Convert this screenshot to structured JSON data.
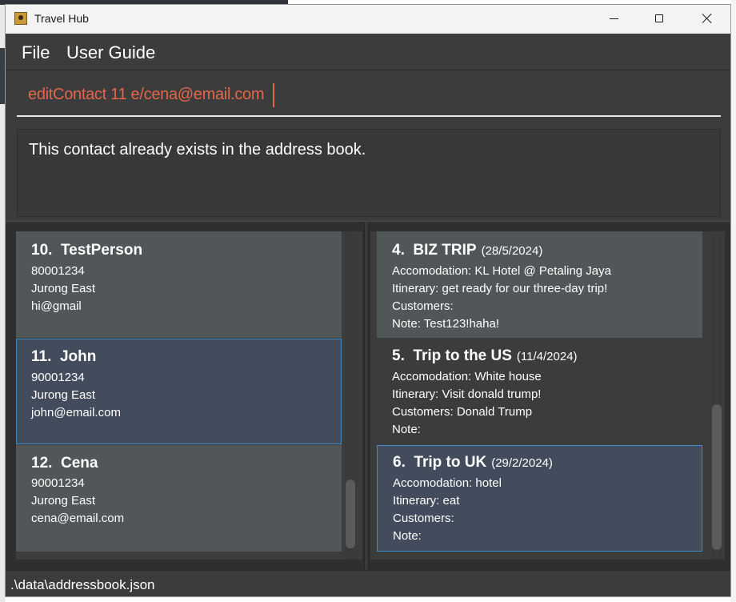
{
  "window": {
    "title": "Travel Hub"
  },
  "menu": {
    "file": "File",
    "user_guide": "User Guide"
  },
  "command": {
    "value": "editContact 11 e/cena@email.com"
  },
  "result": {
    "message": "This contact already exists in the address book."
  },
  "contacts": [
    {
      "index": "10.",
      "name": "TestPerson",
      "phone": "80001234",
      "address": "Jurong East",
      "email": "hi@gmail"
    },
    {
      "index": "11.",
      "name": "John",
      "phone": "90001234",
      "address": "Jurong East",
      "email": "john@email.com"
    },
    {
      "index": "12.",
      "name": "Cena",
      "phone": "90001234",
      "address": "Jurong East",
      "email": "cena@email.com"
    }
  ],
  "trips": [
    {
      "index": "4.",
      "name": "BIZ TRIP",
      "date": "(28/5/2024)",
      "accommodation": "Accomodation: KL Hotel @ Petaling Jaya",
      "itinerary": "Itinerary: get ready for our three-day trip!",
      "customers": "Customers:",
      "note": "Note: Test123!haha!"
    },
    {
      "index": "5.",
      "name": "Trip to the US",
      "date": "(11/4/2024)",
      "accommodation": "Accomodation: White house",
      "itinerary": "Itinerary: Visit donald trump!",
      "customers": "Customers: Donald Trump",
      "note": "Note:"
    },
    {
      "index": "6.",
      "name": "Trip to UK",
      "date": "(29/2/2024)",
      "accommodation": "Accomodation: hotel",
      "itinerary": "Itinerary: eat",
      "customers": "Customers:",
      "note": "Note:"
    }
  ],
  "status": {
    "path": ".\\data\\addressbook.json"
  },
  "colors": {
    "accent": "#3b8ec9",
    "command_text": "#e2674a",
    "selected_card": "#424c5d"
  },
  "icons": {
    "app": "contacts-book-icon",
    "minimize": "minimize-icon",
    "maximize": "maximize-icon",
    "close": "close-icon"
  }
}
